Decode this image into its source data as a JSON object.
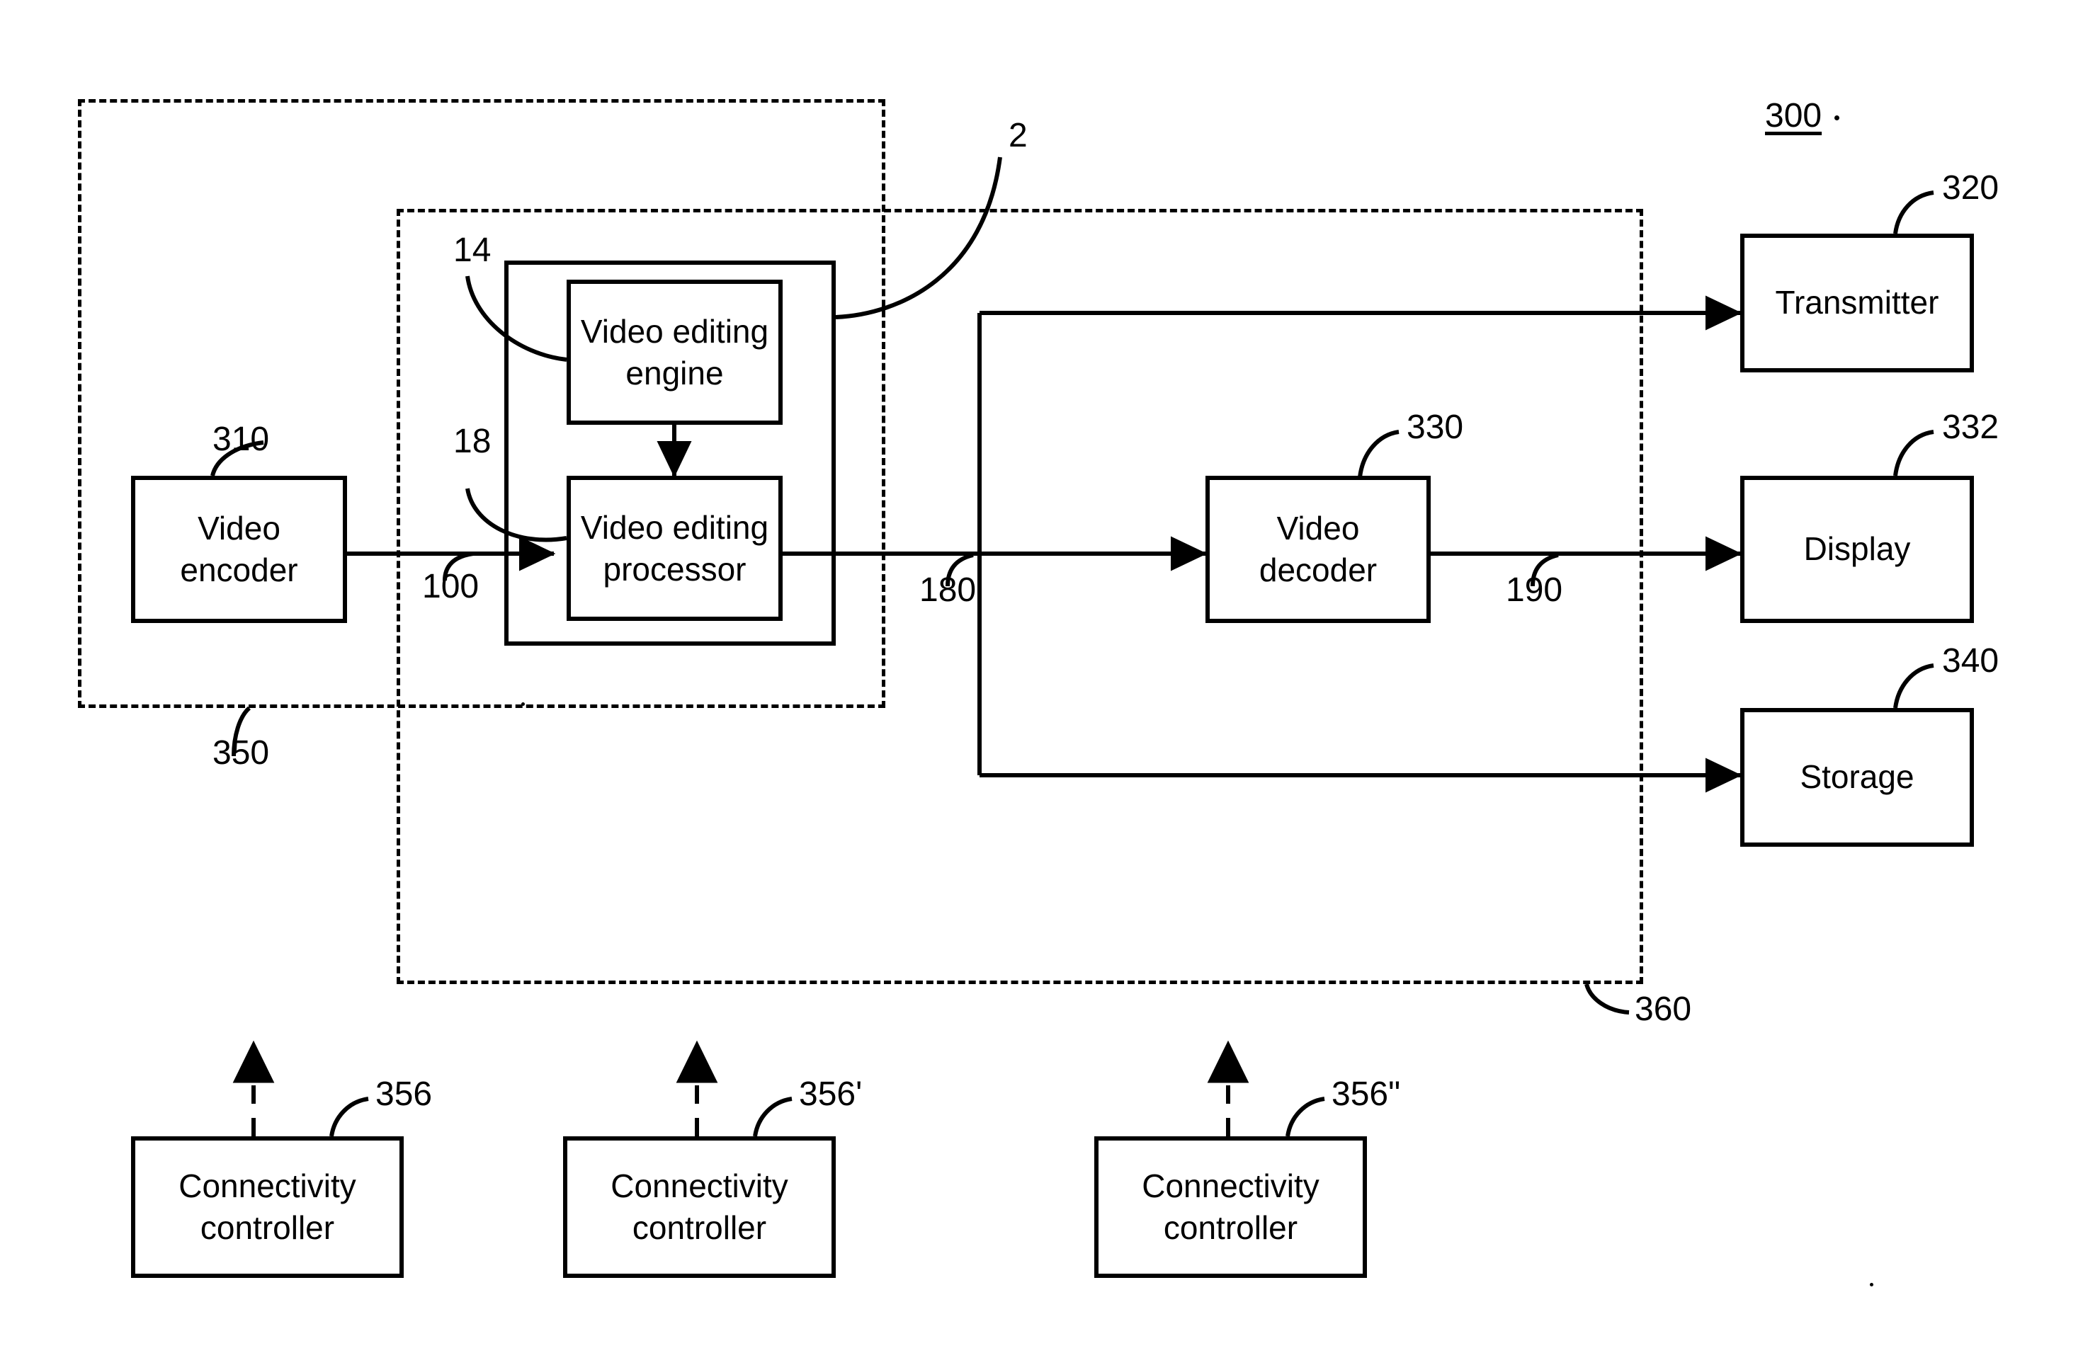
{
  "figure": {
    "figure_number": "300",
    "system_ref": "2"
  },
  "blocks": [
    {
      "id": "video_encoder",
      "label": "Video\nencoder",
      "ref": "310"
    },
    {
      "id": "video_editing_engine",
      "label": "Video editing\nengine",
      "ref": "14"
    },
    {
      "id": "video_editing_processor",
      "label": "Video editing\nprocessor",
      "ref": "18"
    },
    {
      "id": "video_decoder",
      "label": "Video\ndecoder",
      "ref": "330"
    },
    {
      "id": "transmitter",
      "label": "Transmitter",
      "ref": "320"
    },
    {
      "id": "display",
      "label": "Display",
      "ref": "332"
    },
    {
      "id": "storage",
      "label": "Storage",
      "ref": "340"
    },
    {
      "id": "connectivity_controller_1",
      "label": "Connectivity\ncontroller",
      "ref": "356"
    },
    {
      "id": "connectivity_controller_2",
      "label": "Connectivity\ncontroller",
      "ref": "356'"
    },
    {
      "id": "connectivity_controller_3",
      "label": "Connectivity\ncontroller",
      "ref": "356\""
    }
  ],
  "block_labels": {
    "video_encoder_line1": "Video",
    "video_encoder_line2": "encoder",
    "video_editing_engine_line1": "Video editing",
    "video_editing_engine_line2": "engine",
    "video_editing_processor_line1": "Video editing",
    "video_editing_processor_line2": "processor",
    "video_decoder_line1": "Video",
    "video_decoder_line2": "decoder",
    "transmitter": "Transmitter",
    "display": "Display",
    "storage": "Storage",
    "connectivity_controller_line1": "Connectivity",
    "connectivity_controller_line2": "controller"
  },
  "reference_numerals": {
    "figure_300": "300",
    "system_2": "2",
    "engine_14": "14",
    "processor_18": "18",
    "encoder_310": "310",
    "dashed_region_350": "350",
    "dashed_region_360": "360",
    "signal_100": "100",
    "signal_180": "180",
    "signal_190": "190",
    "decoder_330": "330",
    "transmitter_320": "320",
    "display_332": "332",
    "storage_340": "340",
    "connectivity_356": "356",
    "connectivity_356_prime": "356'",
    "connectivity_356_dprime": "356\""
  },
  "colors": {
    "line": "#000000",
    "background": "#ffffff"
  }
}
